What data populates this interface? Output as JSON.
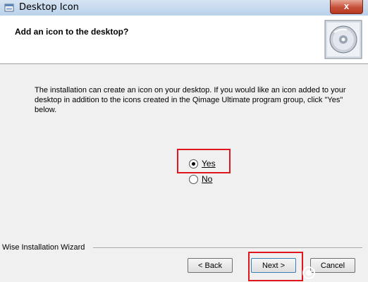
{
  "window": {
    "title": "Desktop Icon",
    "close_glyph": "x",
    "title_icon": "installer-window-icon"
  },
  "header": {
    "title": "Add an icon to the desktop?",
    "image_icon": "cd-disc-icon"
  },
  "body": {
    "description": "The installation can create an icon on your desktop.  If you would like an icon added to your desktop in addition to the icons created in the Qimage Ultimate program group, click \"Yes\" below."
  },
  "options": {
    "yes_label": "Yes",
    "no_label": "No",
    "selected": "Yes"
  },
  "footer": {
    "wizard_label": "Wise Installation Wizard",
    "back_label": "< Back",
    "next_label": "Next >",
    "cancel_label": "Cancel"
  },
  "highlight_color": "#e0161e"
}
